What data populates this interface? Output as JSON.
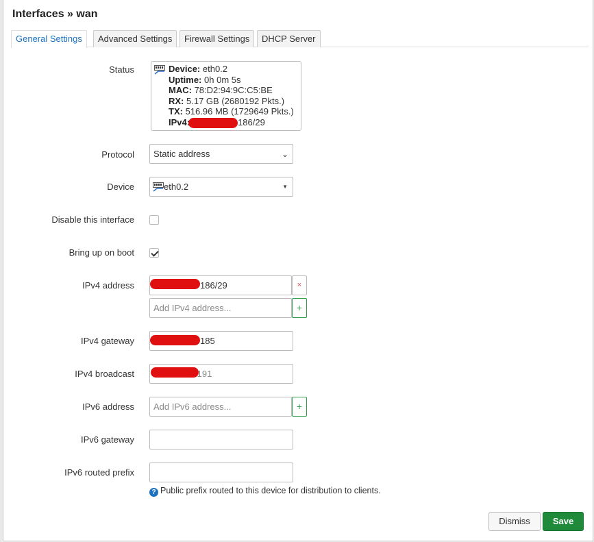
{
  "dialog": {
    "title": "Interfaces » wan"
  },
  "tabs": [
    {
      "label": "General Settings",
      "active": true
    },
    {
      "label": "Advanced Settings",
      "active": false
    },
    {
      "label": "Firewall Settings",
      "active": false
    },
    {
      "label": "DHCP Server",
      "active": false
    }
  ],
  "status": {
    "label": "Status",
    "device_key": "Device:",
    "device_val": "eth0.2",
    "uptime_key": "Uptime:",
    "uptime_val": "0h 0m 5s",
    "mac_key": "MAC:",
    "mac_val": "78:D2:94:9C:C5:BE",
    "rx_key": "RX:",
    "rx_val": "5.17 GB (2680192 Pkts.)",
    "tx_key": "TX:",
    "tx_val": "516.96 MB (1729649 Pkts.)",
    "ipv4_key": "IPv4:",
    "ipv4_val": "186/29"
  },
  "protocol": {
    "label": "Protocol",
    "value": "Static address"
  },
  "device": {
    "label": "Device",
    "value": "eth0.2"
  },
  "disable": {
    "label": "Disable this interface",
    "checked": false
  },
  "boot": {
    "label": "Bring up on boot",
    "checked": true
  },
  "ipv4_address": {
    "label": "IPv4 address",
    "value_suffix": "186/29",
    "remove_symbol": "×",
    "placeholder": "Add IPv4 address...",
    "add_symbol": "+"
  },
  "ipv4_gateway": {
    "label": "IPv4 gateway",
    "value_suffix": "185"
  },
  "ipv4_broadcast": {
    "label": "IPv4 broadcast",
    "value_suffix": ".191"
  },
  "ipv6_address": {
    "label": "IPv6 address",
    "placeholder": "Add IPv6 address...",
    "add_symbol": "+"
  },
  "ipv6_gateway": {
    "label": "IPv6 gateway",
    "value": ""
  },
  "ipv6_prefix": {
    "label": "IPv6 routed prefix",
    "value": "",
    "hint": "Public prefix routed to this device for distribution to clients.",
    "hint_icon": "?"
  },
  "actions": {
    "dismiss": "Dismiss",
    "save": "Save"
  },
  "colors": {
    "accent": "#1c72c1",
    "save": "#1e8a3a",
    "redaction": "#e01010"
  }
}
